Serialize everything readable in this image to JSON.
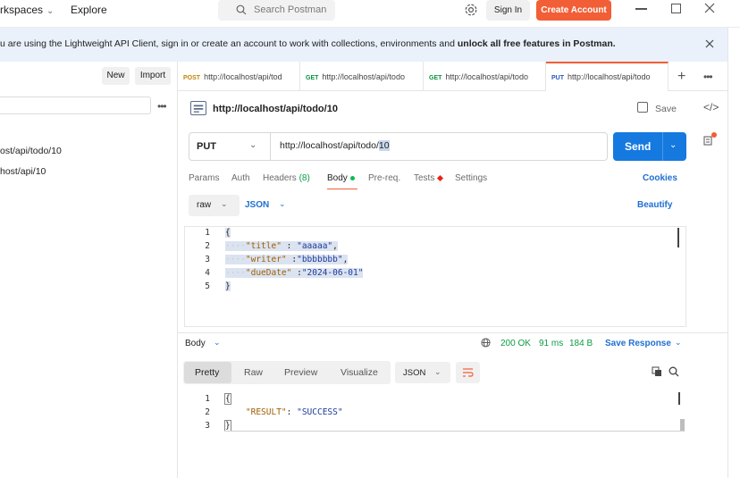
{
  "topbar": {
    "workspaces_label": "rkspaces",
    "explore_label": "Explore",
    "search_placeholder": "Search Postman",
    "signin_label": "Sign In",
    "create_label": "Create Account"
  },
  "banner": {
    "text_pre": "u are using the Lightweight API Client, sign in or create an account to work with collections, environments and ",
    "text_bold": "unlock all free features in Postman."
  },
  "sidebar": {
    "new_label": "New",
    "import_label": "Import",
    "items": [
      {
        "label": "ost/api/todo/10"
      },
      {
        "label": "host/api/10"
      }
    ]
  },
  "tabs": [
    {
      "method": "POST",
      "label": "http://localhost/api/tod",
      "method_color": "#c2830a"
    },
    {
      "method": "GET",
      "label": "http://localhost/api/todo",
      "method_color": "#0c8f40"
    },
    {
      "method": "GET",
      "label": "http://localhost/api/todo",
      "method_color": "#0c8f40"
    },
    {
      "method": "PUT",
      "label": "http://localhost/api/todo",
      "method_color": "#2357c2",
      "active": true
    }
  ],
  "request": {
    "title": "http://localhost/api/todo/10",
    "save_label": "Save",
    "method": "PUT",
    "url_pre": "http://localhost/api/todo/",
    "url_sel": "10",
    "send_label": "Send",
    "subtabs": {
      "params": "Params",
      "auth": "Auth",
      "headers": "Headers",
      "headers_count": "(8)",
      "body": "Body",
      "prereq": "Pre-req.",
      "tests": "Tests",
      "settings": "Settings"
    },
    "cookies_label": "Cookies",
    "body_mode": "raw",
    "body_format": "JSON",
    "beautify_label": "Beautify",
    "body_lines": {
      "l1": "{",
      "l2_key": "\"title\"",
      "l2_sep": " : ",
      "l2_val": "\"aaaaa\"",
      "l2_end": ",",
      "l3_key": "\"writer\"",
      "l3_sep": " :",
      "l3_val": "\"bbbbbbb\"",
      "l3_end": ",",
      "l4_key": "\"dueDate\"",
      "l4_sep": " :",
      "l4_val": "\"2024-06-01\"",
      "l5": "}"
    },
    "line_numbers": [
      "1",
      "2",
      "3",
      "4",
      "5"
    ]
  },
  "response": {
    "body_label": "Body",
    "status": "200 OK",
    "time": "91 ms",
    "size": "184 B",
    "save_response_label": "Save Response",
    "views": {
      "pretty": "Pretty",
      "raw": "Raw",
      "preview": "Preview",
      "visualize": "Visualize"
    },
    "format": "JSON",
    "lines": {
      "l1": "{",
      "l2_key": "\"RESULT\"",
      "l2_sep": ": ",
      "l2_val": "\"SUCCESS\"",
      "l3": "}"
    },
    "line_numbers": [
      "1",
      "2",
      "3"
    ]
  },
  "colors": {
    "accent": "#f25e35",
    "send": "#1579e0",
    "link": "#1f6fd1",
    "status_ok": "#0c9c44"
  }
}
